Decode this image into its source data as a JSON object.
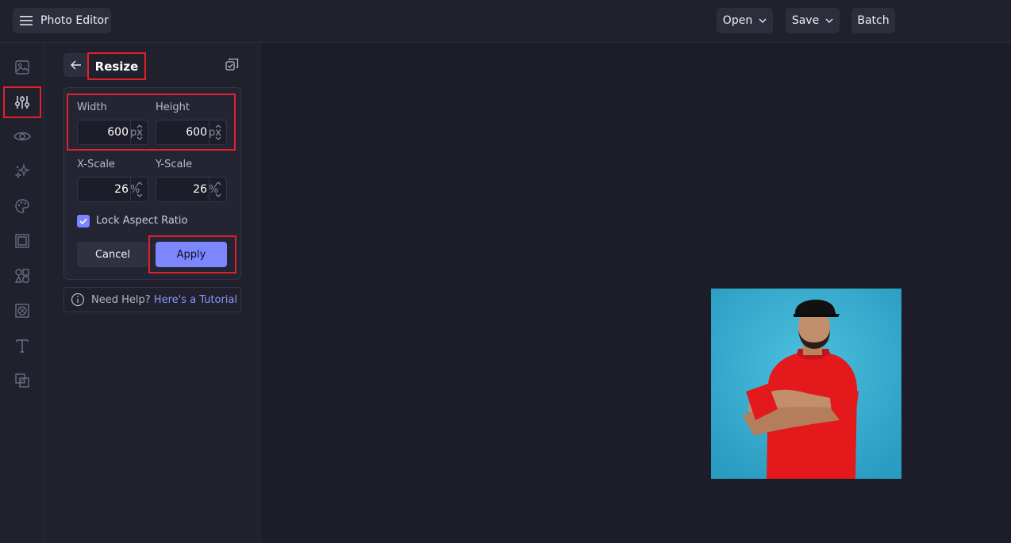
{
  "app": {
    "menu_label": "Photo Editor"
  },
  "toolbar": {
    "open_label": "Open",
    "save_label": "Save",
    "batch_label": "Batch"
  },
  "rail": {
    "items": [
      {
        "icon": "image-icon"
      },
      {
        "icon": "sliders-icon",
        "active": true
      },
      {
        "icon": "eye-icon"
      },
      {
        "icon": "sparkles-icon"
      },
      {
        "icon": "palette-icon"
      },
      {
        "icon": "frame-icon"
      },
      {
        "icon": "shapes-icon"
      },
      {
        "icon": "texture-icon"
      },
      {
        "icon": "text-icon"
      },
      {
        "icon": "layers-icon"
      }
    ]
  },
  "panel": {
    "title": "Resize",
    "width_label": "Width",
    "height_label": "Height",
    "width_value": "600",
    "height_value": "600",
    "size_unit": "px",
    "xscale_label": "X-Scale",
    "yscale_label": "Y-Scale",
    "xscale_value": "26",
    "yscale_value": "26",
    "scale_unit": "%",
    "lock_label": "Lock Aspect Ratio",
    "lock_checked": true,
    "cancel_label": "Cancel",
    "apply_label": "Apply"
  },
  "help": {
    "text": "Need Help?",
    "link": "Here's a Tutorial"
  },
  "colors": {
    "accent": "#7c87ff",
    "highlight": "#e0212d",
    "background": "#1c1d28"
  }
}
